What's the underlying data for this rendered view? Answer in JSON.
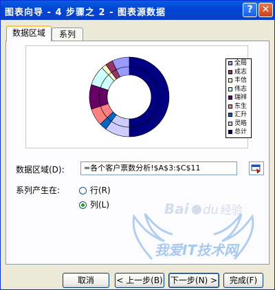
{
  "window": {
    "title": "图表向导 - 4 步骤之 2 - 图表源数据",
    "help_label": "?",
    "close_label": "✕"
  },
  "tabs": [
    {
      "label": "数据区域",
      "active": true
    },
    {
      "label": "系列",
      "active": false
    }
  ],
  "chart_data": {
    "type": "pie",
    "rings": [
      [
        {
          "value": 50,
          "color": "#000080"
        },
        {
          "value": 10,
          "color": "#ccccff"
        },
        {
          "value": 3,
          "color": "#0066cc"
        },
        {
          "value": 7,
          "color": "#ff8080"
        },
        {
          "value": 10,
          "color": "#660066"
        },
        {
          "value": 8,
          "color": "#ccffff"
        },
        {
          "value": 2,
          "color": "#ffffcc"
        },
        {
          "value": 3,
          "color": "#993366"
        },
        {
          "value": 7,
          "color": "#9999ff"
        }
      ],
      [
        {
          "value": 50,
          "color": "#000080"
        },
        {
          "value": 10,
          "color": "#ccccff"
        },
        {
          "value": 3,
          "color": "#0066cc"
        },
        {
          "value": 7,
          "color": "#ff8080"
        },
        {
          "value": 10,
          "color": "#660066"
        },
        {
          "value": 8,
          "color": "#ccffff"
        },
        {
          "value": 2,
          "color": "#ffffcc"
        },
        {
          "value": 3,
          "color": "#993366"
        },
        {
          "value": 7,
          "color": "#9999ff"
        }
      ]
    ],
    "legend": [
      {
        "label": "全局",
        "color": "#9999ff"
      },
      {
        "label": "成志",
        "color": "#993366"
      },
      {
        "label": "丰信",
        "color": "#ffffcc"
      },
      {
        "label": "伟志",
        "color": "#ccffff"
      },
      {
        "label": "瑞祥",
        "color": "#660066"
      },
      {
        "label": "东生",
        "color": "#ff8080"
      },
      {
        "label": "汇升",
        "color": "#0066cc"
      },
      {
        "label": "灵皓",
        "color": "#ccccff"
      },
      {
        "label": "总计",
        "color": "#000080"
      }
    ]
  },
  "form": {
    "range_label": "数据区域(D):",
    "range_value": "=各个客户票数分析!$A$3:$C$11",
    "series_label": "系列产生在:",
    "options": [
      {
        "label": "行(R)",
        "selected": false
      },
      {
        "label": "列(L)",
        "selected": true
      }
    ]
  },
  "buttons": {
    "cancel": "取消",
    "back": "< 上一步(B)",
    "next": "下一步(N) >",
    "finish": "完成(F)"
  },
  "watermark": {
    "brand": "Bai",
    "du": "du",
    "jingyan": "经验",
    "site": "我爱IT技术网"
  },
  "colors": {
    "title_bar": "#0046d5",
    "dialog_bg": "#ece9d8",
    "tab_highlight": "#ffc73c"
  }
}
